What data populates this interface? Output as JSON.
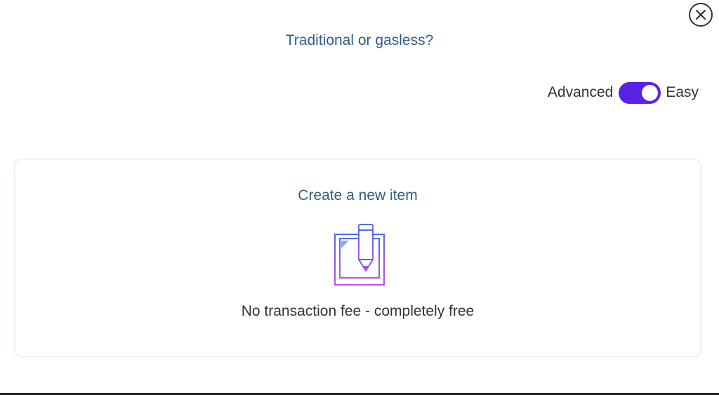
{
  "modal": {
    "title": "Traditional or gasless?"
  },
  "mode_toggle": {
    "left_label": "Advanced",
    "right_label": "Easy",
    "selected": "Easy",
    "accent_color": "#5b21e6"
  },
  "option_card": {
    "title": "Create a new item",
    "icon": "edit-document-icon",
    "description": "No transaction fee - completely free"
  },
  "icons": {
    "close": "close-circle-icon",
    "option": "edit-document-icon"
  },
  "colors": {
    "title_text": "#2f5d86",
    "body_text": "#333333",
    "icon_gradient_start": "#4a6cf0",
    "icon_gradient_end": "#c24fe0"
  }
}
